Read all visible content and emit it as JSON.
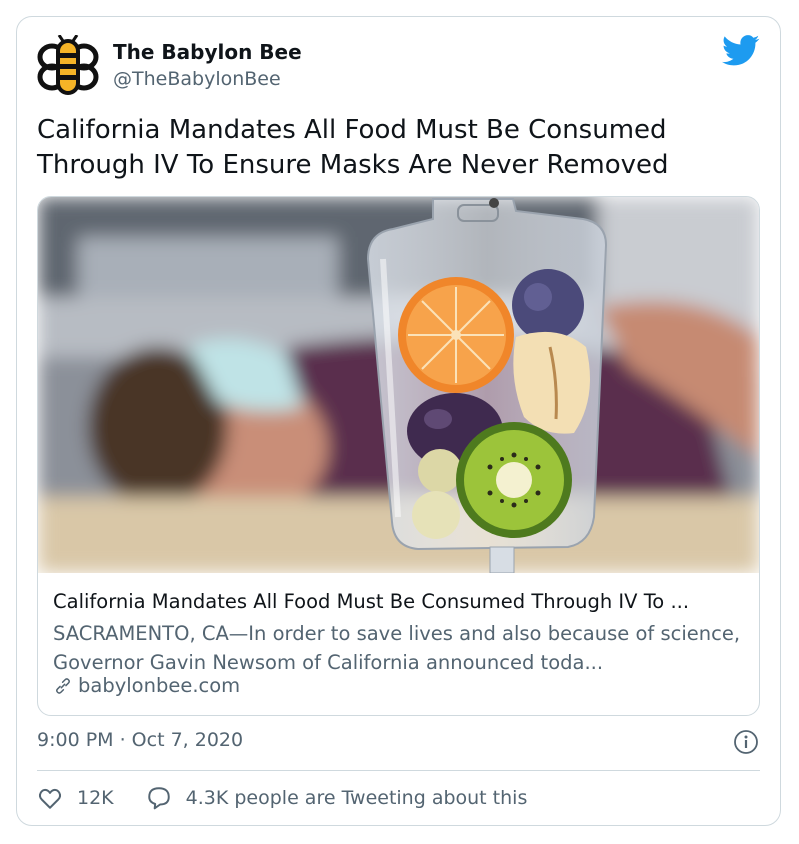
{
  "tweet": {
    "display_name": "The Babylon Bee",
    "handle": "@TheBabylonBee",
    "text": "California Mandates All Food Must Be Consumed Through IV To Ensure Masks Are Never Removed",
    "timestamp": "9:00 PM · Oct 7, 2020"
  },
  "link_card": {
    "title": "California Mandates All Food Must Be Consumed Through IV To ...",
    "description": "SACRAMENTO, CA—In order to save lives and also because of science, Governor Gavin Newsom of California announced toda...",
    "domain": "babylonbee.com",
    "image_subject": "blurred man with face mask lying down beside an IV bag filled with fruit"
  },
  "actions": {
    "likes": "12K",
    "tweeting": "4.3K people are Tweeting about this"
  },
  "colors": {
    "twitter_blue": "#1d9bf0",
    "text_primary": "#0f1419",
    "text_secondary": "#536471",
    "border": "#cfd9de",
    "bee_gold": "#f5b427"
  },
  "icons": [
    "babylon-bee-logo",
    "twitter-bird-icon",
    "link-icon",
    "info-icon",
    "heart-icon",
    "speech-bubble-icon"
  ]
}
